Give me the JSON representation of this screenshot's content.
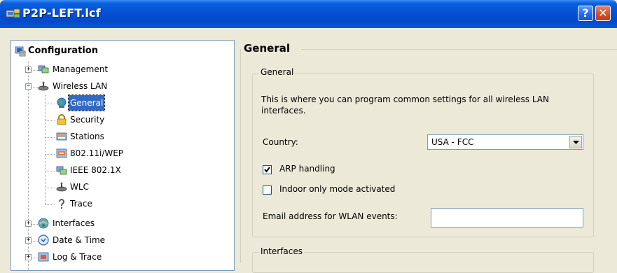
{
  "window": {
    "title": "P2P-LEFT.lcf",
    "help_button": "?",
    "close_button": "✕"
  },
  "tree": {
    "root": "Configuration",
    "items": [
      {
        "label": "Management",
        "icon": "computers-icon",
        "expander": "+"
      },
      {
        "label": "Wireless LAN",
        "icon": "access-point-icon",
        "expander": "−"
      },
      {
        "label": "General",
        "icon": "globe-icon",
        "selected": true
      },
      {
        "label": "Security",
        "icon": "lock-icon"
      },
      {
        "label": "Stations",
        "icon": "stations-icon"
      },
      {
        "label": "802.11i/WEP",
        "icon": "wep-icon"
      },
      {
        "label": "IEEE 802.1X",
        "icon": "network-icon"
      },
      {
        "label": "WLC",
        "icon": "access-point-icon"
      },
      {
        "label": "Trace",
        "icon": "question-icon"
      },
      {
        "label": "Interfaces",
        "icon": "interfaces-icon",
        "expander": "+"
      },
      {
        "label": "Date & Time",
        "icon": "clock-icon",
        "expander": "+"
      },
      {
        "label": "Log & Trace",
        "icon": "log-icon",
        "expander": "+"
      }
    ]
  },
  "panel": {
    "section_title": "General",
    "group_general": {
      "legend": "General",
      "description": "This is where you can program common settings for all wireless LAN interfaces.",
      "country_label": "Country:",
      "country_value": "USA - FCC",
      "arp_label": "ARP handling",
      "arp_checked": true,
      "indoor_label": "Indoor only mode activated",
      "indoor_checked": false,
      "email_label": "Email address for WLAN events:",
      "email_value": ""
    },
    "group_interfaces": {
      "legend": "Interfaces"
    }
  },
  "colors": {
    "titlebar": "#0551D4",
    "selection": "#316AC5",
    "window_bg": "#ECE9D8"
  }
}
